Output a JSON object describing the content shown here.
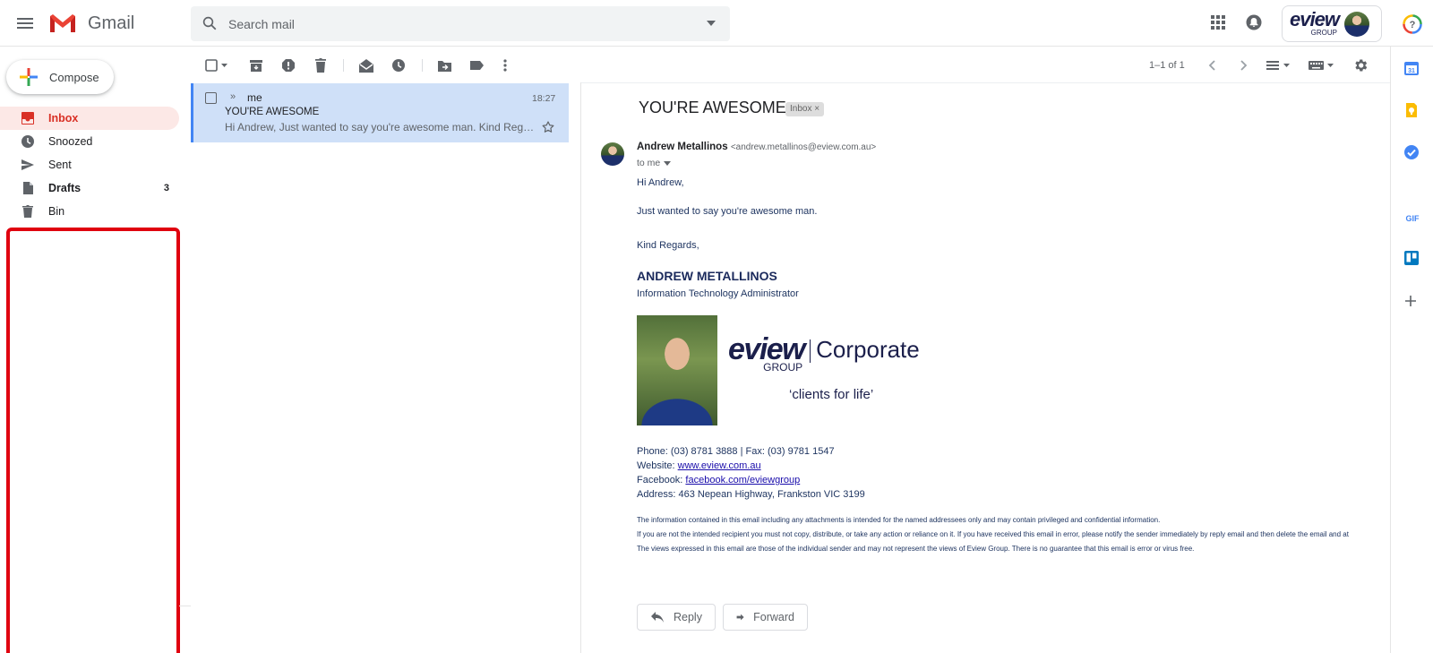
{
  "app": {
    "name": "Gmail"
  },
  "search": {
    "placeholder": "Search mail"
  },
  "brand": {
    "top": "eview",
    "bottom": "GROUP"
  },
  "compose": {
    "label": "Compose"
  },
  "nav": {
    "items": [
      {
        "label": "Inbox",
        "count": ""
      },
      {
        "label": "Snoozed",
        "count": ""
      },
      {
        "label": "Sent",
        "count": ""
      },
      {
        "label": "Drafts",
        "count": "3"
      },
      {
        "label": "Bin",
        "count": ""
      }
    ]
  },
  "toolbar": {
    "pager": "1–1 of 1"
  },
  "list": {
    "rows": [
      {
        "importance": "»",
        "sender": "me",
        "time": "18:27",
        "subject": "YOU'RE AWESOME",
        "snippet": "Hi Andrew, Just wanted to say you're awesome man. Kind Regards,"
      }
    ]
  },
  "message": {
    "subject": "YOU'RE AWESOME",
    "label_chip": "Inbox ×",
    "sender_name": "Andrew Metallinos",
    "sender_email": "<andrew.metallinos@eview.com.au>",
    "to": "to me",
    "greeting": "Hi Andrew,",
    "line1": "Just wanted to say you're awesome man.",
    "signoff": "Kind Regards,",
    "sig_name": "ANDREW METALLINOS",
    "sig_title": "Information Technology Administrator",
    "sig_brand": "eview",
    "sig_group": "GROUP",
    "sig_corporate": "Corporate",
    "sig_tagline": "‘clients for life’",
    "phone": "Phone: (03) 8781 3888 | Fax: (03) 9781 1547",
    "website_label": "Website: ",
    "website": "www.eview.com.au",
    "facebook_label": "Facebook: ",
    "facebook": "facebook.com/eviewgroup",
    "address": "Address: 463 Nepean Highway, Frankston VIC 3199",
    "disclaimer1": "The information contained in this email including any attachments is intended for the named addressees only and may contain privileged and confidential information.",
    "disclaimer2": "If you are not the intended recipient you must not copy, distribute, or take any action or reliance on it. If you have received this email in error, please notify the sender immediately by reply email and then delete the email and at",
    "disclaimer3": "The views expressed in this email are those of the individual sender and may not represent the views of Eview Group. There is no guarantee that this email is error or virus free."
  },
  "actions": {
    "reply": "Reply",
    "forward": "Forward"
  },
  "rail": {
    "gif_label": "GIF",
    "calendar_day": "31"
  },
  "colors": {
    "inbox_red": "#d93025",
    "selected_row": "#cfe0f8",
    "highlight_box": "#e0000f",
    "brand_navy": "#1b1f4b"
  }
}
